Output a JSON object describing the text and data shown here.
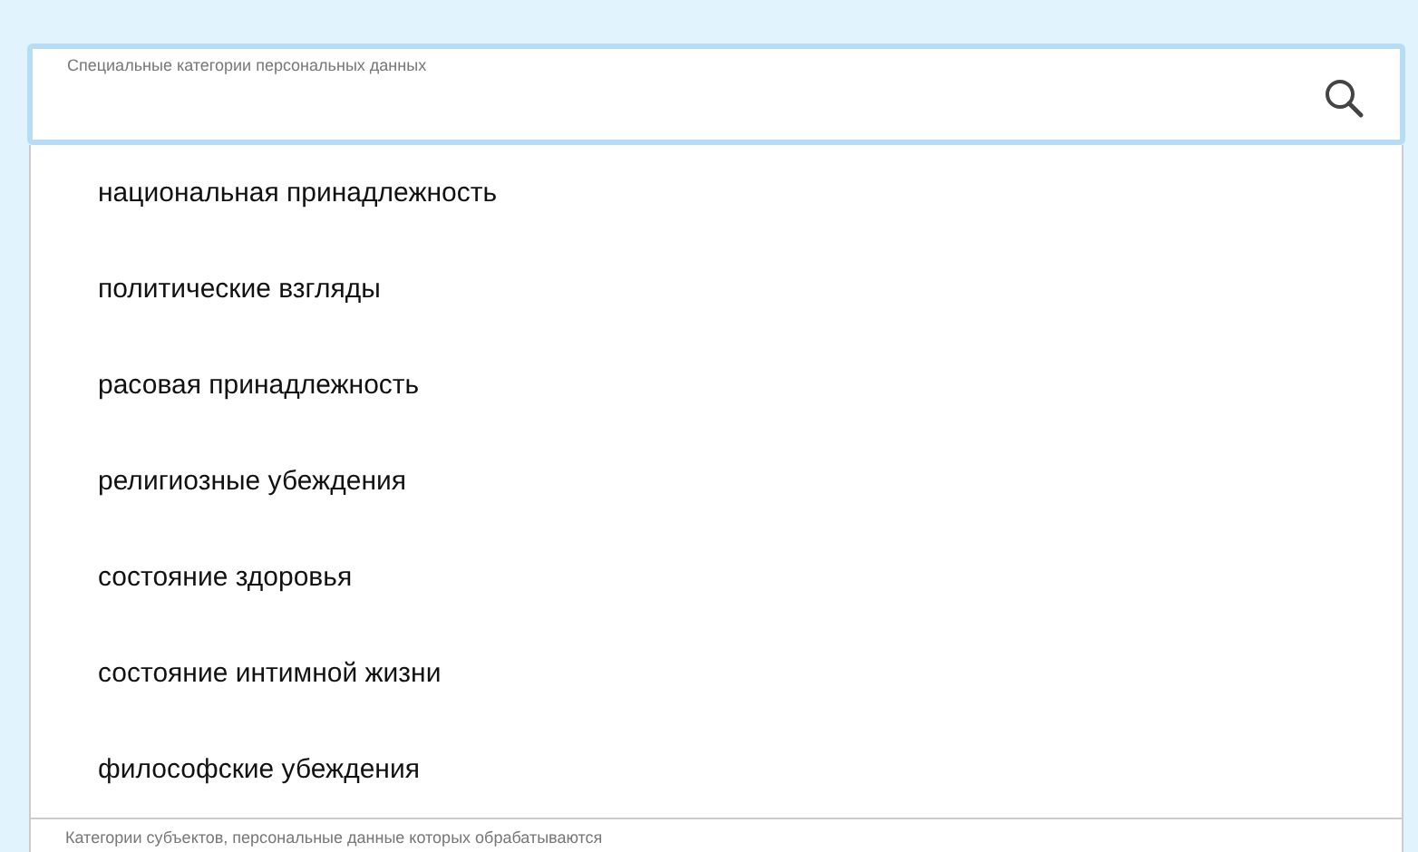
{
  "search_field": {
    "label": "Специальные категории персональных данных"
  },
  "options": [
    {
      "label": "национальная принадлежность"
    },
    {
      "label": "политические взгляды"
    },
    {
      "label": "расовая принадлежность"
    },
    {
      "label": "религиозные убеждения"
    },
    {
      "label": "состояние здоровья"
    },
    {
      "label": "состояние интимной жизни"
    },
    {
      "label": "философские убеждения"
    }
  ],
  "next_field": {
    "label": "Категории субъектов, персональные данные которых обрабатываются"
  }
}
